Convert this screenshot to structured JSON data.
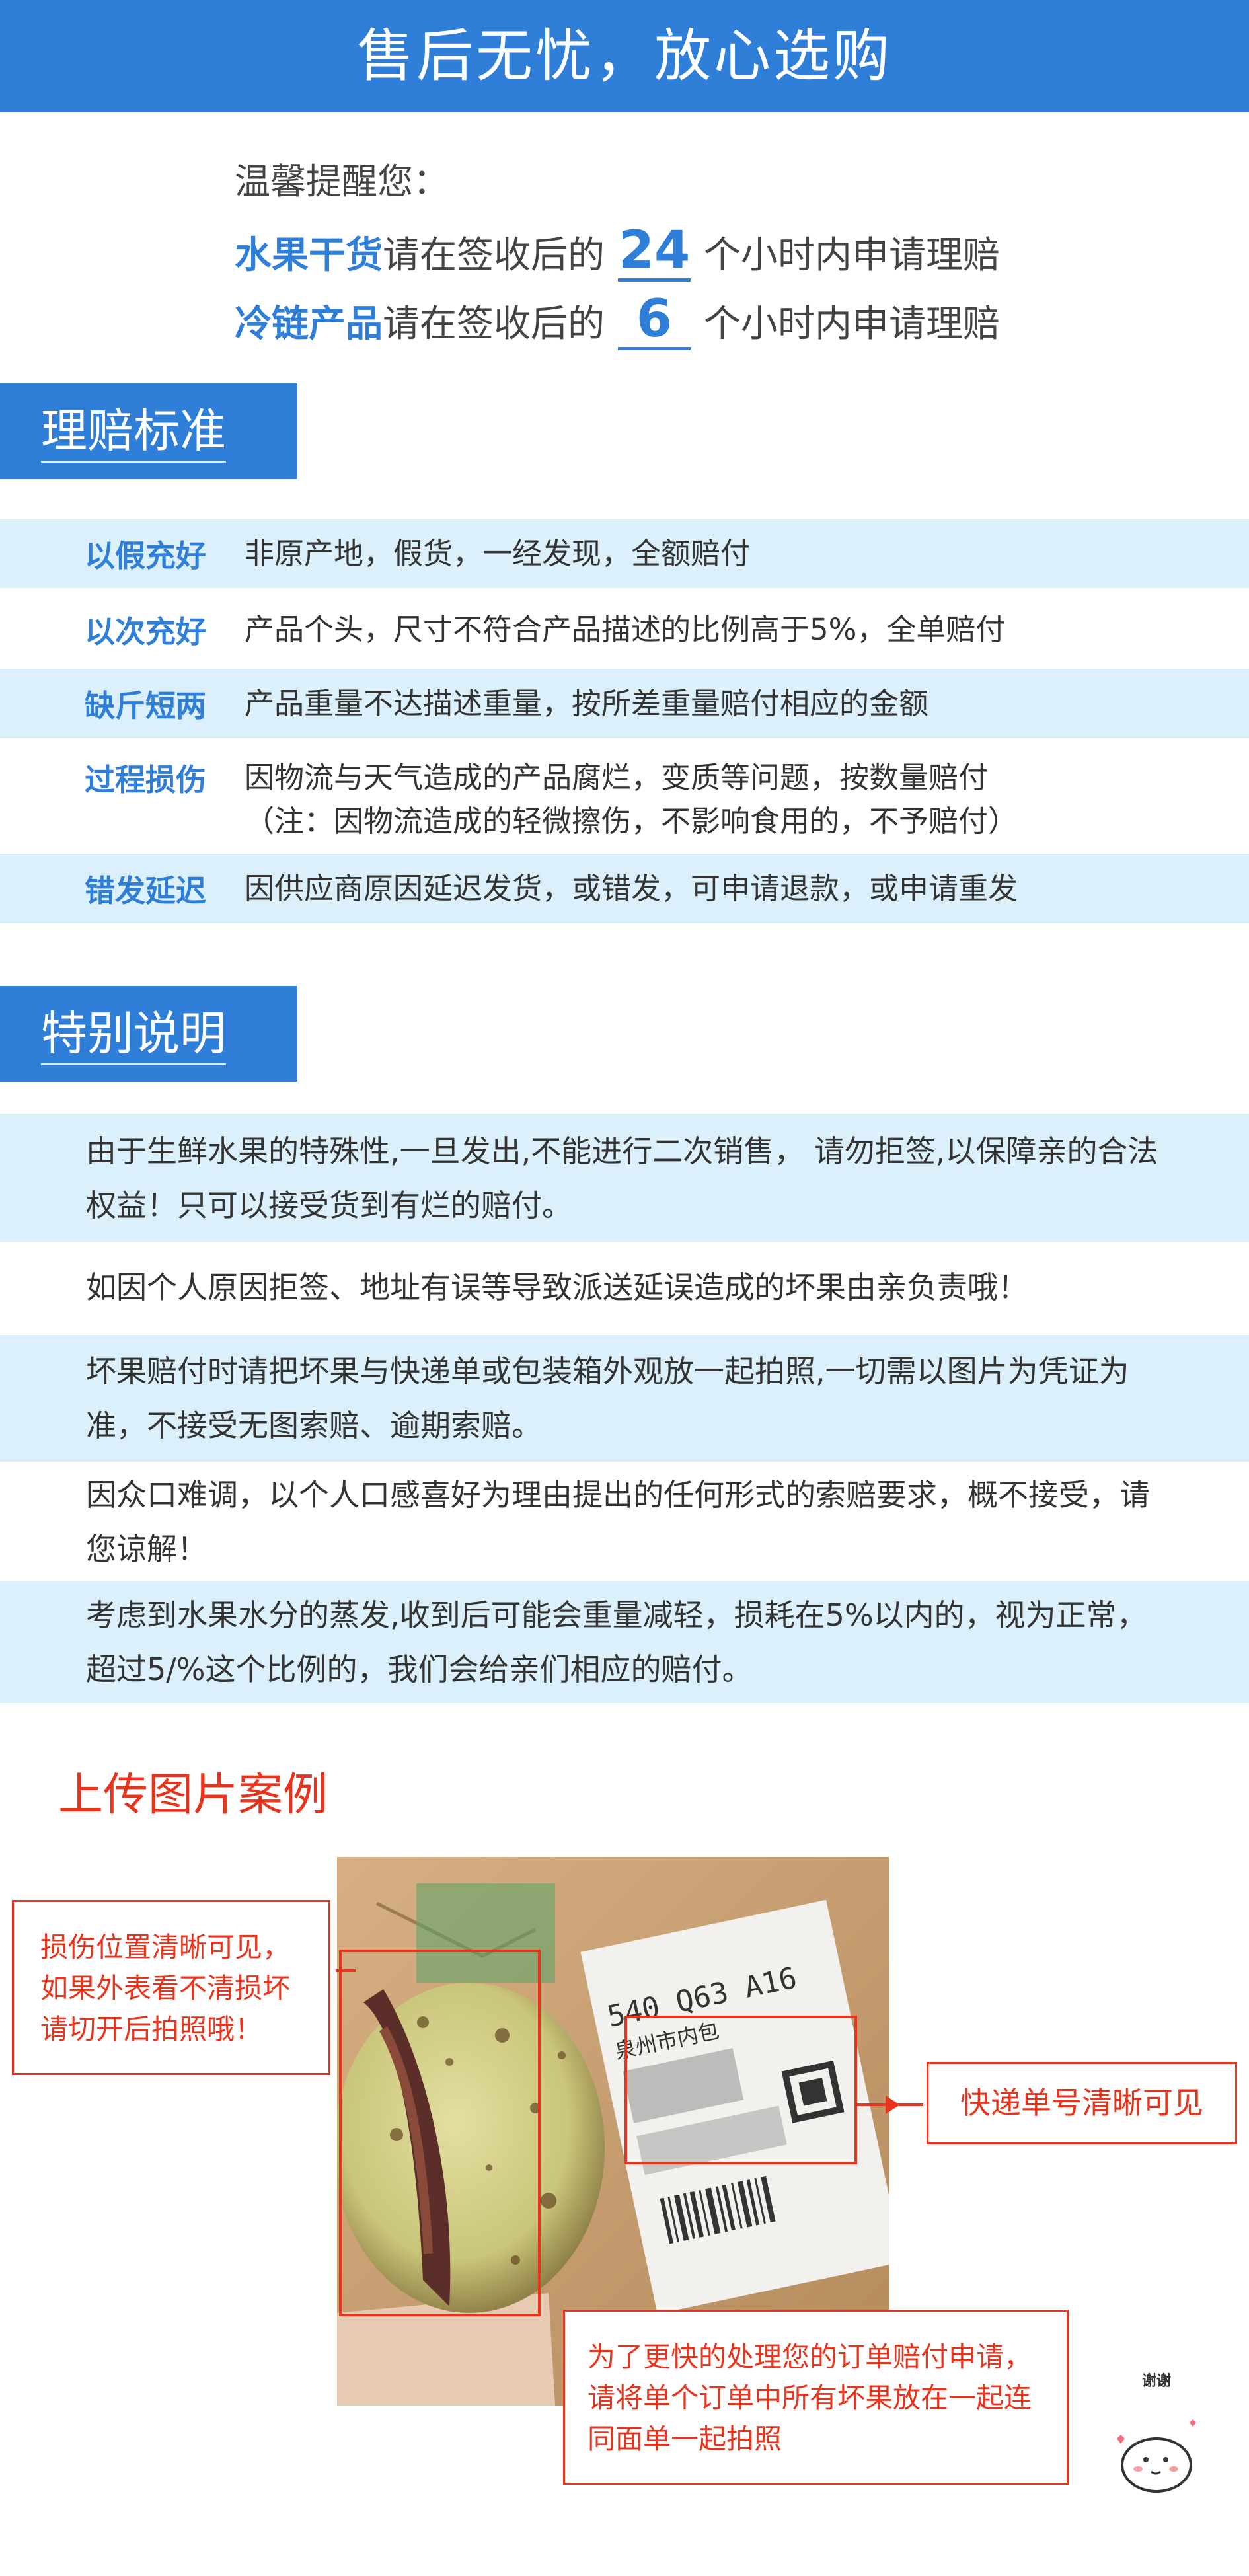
{
  "banner": {
    "title": "售后无忧，放心选购"
  },
  "reminder": {
    "lead": "温馨提醒您：",
    "rows": [
      {
        "category": "水果干货",
        "prefix": "请在签收后的",
        "hours": "24",
        "suffix": "个小时内申请理赔"
      },
      {
        "category": "冷链产品",
        "prefix": "请在签收后的",
        "hours": "6",
        "suffix": "个小时内申请理赔"
      }
    ]
  },
  "standards": {
    "title": "理赔标准",
    "items": [
      {
        "key": "以假充好",
        "value": "非原产地，假货，一经发现，全额赔付"
      },
      {
        "key": "以次充好",
        "value": "产品个头，尺寸不符合产品描述的比例高于5%，全单赔付"
      },
      {
        "key": "缺斤短两",
        "value": "产品重量不达描述重量，按所差重量赔付相应的金额"
      },
      {
        "key": "过程损伤",
        "value": "因物流与天气造成的产品腐烂，变质等问题，按数量赔付",
        "note": "（注：因物流造成的轻微擦伤，不影响食用的，不予赔付）"
      },
      {
        "key": "错发延迟",
        "value": "因供应商原因延迟发货，或错发，可申请退款，或申请重发"
      }
    ]
  },
  "special": {
    "title": "特别说明",
    "items": [
      "由于生鲜水果的特殊性,一旦发出,不能进行二次销售， 请勿拒签,以保障亲的合法权益！只可以接受货到有烂的赔付。",
      "如因个人原因拒签、地址有误等导致派送延误造成的坏果由亲负责哦！",
      "坏果赔付时请把坏果与快递单或包装箱外观放一起拍照,一切需以图片为凭证为准，不接受无图索赔、逾期索赔。",
      "因众口难调，以个人口感喜好为理由提出的任何形式的索赔要求，概不接受，请您谅解！",
      "考虑到水果水分的蒸发,收到后可能会重量减轻，损耗在5%以内的，视为正常，超过5/%这个比例的，我们会给亲们相应的赔付。"
    ]
  },
  "upload_case": {
    "title": "上传图片案例",
    "callout_damage": "损伤位置清晰可见，如果外表看不清损坏请切开后拍照哦！",
    "callout_tracking": "快递单号清晰可见",
    "callout_order": "为了更快的处理您的订单赔付申请，请将单个订单中所有坏果放在一起连同面单一起拍照",
    "label_text": "540 Q63 A16",
    "label_city": "泉州市内包",
    "mascot_text": "谢谢"
  },
  "colors": {
    "accent": "#2f7fd8",
    "row_tint": "#dbf0fa",
    "alert": "#e8341c"
  }
}
